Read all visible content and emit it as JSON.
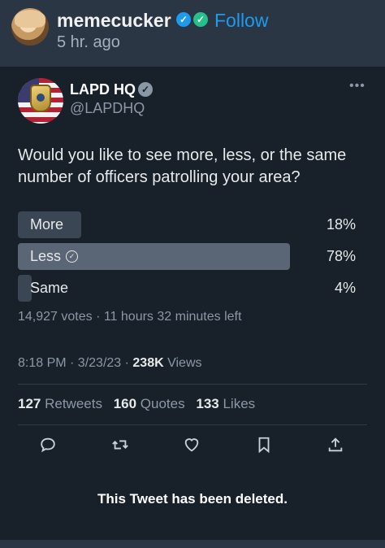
{
  "header": {
    "username": "memecucker",
    "follow_label": "Follow",
    "time_ago": "5 hr. ago"
  },
  "tweet": {
    "author_name": "LAPD HQ",
    "author_handle": "@LAPDHQ",
    "more_icon": "more-horizontal-icon",
    "text": "Would you like to see more, less, or the same number of officers patrolling your area?",
    "poll": {
      "options": [
        {
          "label": "More",
          "percent_text": "18%",
          "percent": 18,
          "winner": false
        },
        {
          "label": "Less",
          "percent_text": "78%",
          "percent": 78,
          "winner": true
        },
        {
          "label": "Same",
          "percent_text": "4%",
          "percent": 4,
          "winner": false
        }
      ],
      "meta": "14,927 votes · 11 hours 32 minutes left"
    },
    "timestamp_text": "8:18 PM · 3/23/23 · ",
    "views_count": "238K",
    "views_label": " Views",
    "stats": {
      "retweets_count": "127",
      "retweets_label": " Retweets",
      "quotes_count": "160",
      "quotes_label": " Quotes",
      "likes_count": "133",
      "likes_label": " Likes"
    },
    "actions": [
      "reply-icon",
      "retweet-icon",
      "like-icon",
      "bookmark-icon",
      "share-icon"
    ],
    "deleted_notice": "This Tweet has been deleted."
  },
  "colors": {
    "accent": "#1d9bf0",
    "verified_green": "#27c08a",
    "winner_bar": "#5a6675",
    "other_bar": "#3b4654"
  }
}
